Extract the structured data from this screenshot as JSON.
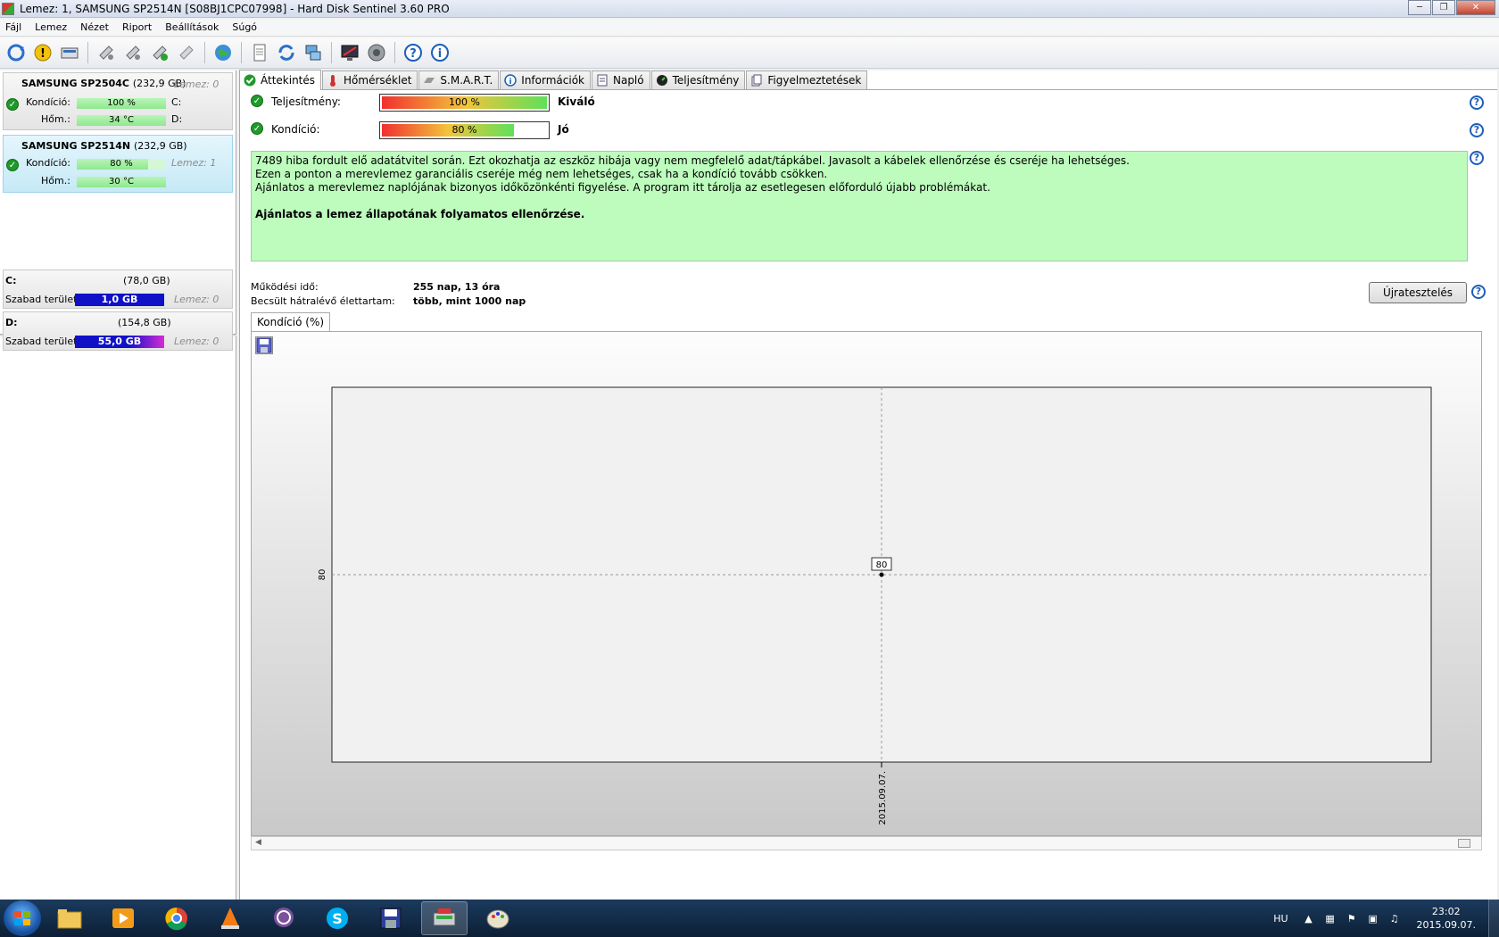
{
  "window": {
    "title": "Lemez: 1, SAMSUNG SP2514N [S08BJ1CPC07998]  -  Hard Disk Sentinel 3.60 PRO"
  },
  "menu": [
    "Fájl",
    "Lemez",
    "Nézet",
    "Riport",
    "Beállítások",
    "Súgó"
  ],
  "toolbar_icons": [
    "refresh-icon",
    "alert-icon",
    "disk-icon",
    "satellite-icon",
    "satellite-icon",
    "satellite-check-icon",
    "satellite-off-icon",
    "globe-icon",
    "document-icon",
    "sync-icon",
    "network-icon",
    "monitor-icon",
    "speaker-icon",
    "help-icon",
    "info-icon"
  ],
  "disks": [
    {
      "name": "SAMSUNG SP2504C",
      "size": "(232,9 GB)",
      "disk_no": "Lemez: 0",
      "cond_label": "Kondíció:",
      "cond_value": "100 %",
      "cond_pct": 100,
      "temp_label": "Hőm.:",
      "temp_value": "34 °C",
      "drive1": "C:",
      "drive2": "D:"
    },
    {
      "name": "SAMSUNG SP2514N",
      "size": "(232,9 GB)",
      "disk_no": "Lemez: 1",
      "cond_label": "Kondíció:",
      "cond_value": "80 %",
      "cond_pct": 80,
      "temp_label": "Hőm.:",
      "temp_value": "30 °C"
    }
  ],
  "volumes": [
    {
      "letter": "C:",
      "size": "(78,0 GB)",
      "free_label": "Szabad terület",
      "free_value": "1,0 GB",
      "disk_no": "Lemez: 0"
    },
    {
      "letter": "D:",
      "size": "(154,8 GB)",
      "free_label": "Szabad terület",
      "free_value": "55,0 GB",
      "disk_no": "Lemez: 0"
    }
  ],
  "tabs": [
    "Áttekintés",
    "Hőmérséklet",
    "S.M.A.R.T.",
    "Információk",
    "Napló",
    "Teljesítmény",
    "Figyelmeztetések"
  ],
  "overview": {
    "perf_label": "Teljesítmény:",
    "perf_value": "100 %",
    "perf_pct": 100,
    "perf_rating": "Kiváló",
    "cond_label": "Kondíció:",
    "cond_value": "80 %",
    "cond_pct": 80,
    "cond_rating": "Jó",
    "message": [
      "7489 hiba fordult elő adatátvitel során. Ezt okozhatja az eszköz hibája vagy nem megfelelő adat/tápkábel. Javasolt a kábelek ellenőrzése és cseréje ha lehetséges.",
      "Ezen a ponton a merevlemez garanciális cseréje még nem lehetséges, csak ha a kondíció tovább csökken.",
      "Ajánlatos a merevlemez naplójának bizonyos időközönkénti figyelése. A program itt tárolja az esetlegesen előforduló újabb problémákat."
    ],
    "message_bold": "Ajánlatos a lemez állapotának folyamatos ellenőrzése.",
    "uptime_label": "Működési idő:",
    "uptime_value": "255 nap, 13 óra",
    "life_label": "Becsült hátralévő élettartam:",
    "life_value": "több, mint 1000 nap",
    "retest_label": "Újratesztelés",
    "graph_tab": "Kondíció  (%)"
  },
  "chart_data": {
    "type": "line",
    "x": [
      "2015.09.07."
    ],
    "values": [
      80
    ],
    "data_labels": [
      "80"
    ],
    "y_ticks": [
      "80"
    ],
    "grid": true,
    "colors": {
      "point": "#000000",
      "grid": "#999999"
    }
  },
  "taskbar": {
    "apps": [
      "explorer-icon",
      "media-player-icon",
      "chrome-icon",
      "vlc-icon",
      "viber-icon",
      "skype-icon",
      "save-icon",
      "hdsentinel-icon",
      "paint-icon"
    ],
    "lang": "HU",
    "time": "23:02",
    "date": "2015.09.07."
  }
}
